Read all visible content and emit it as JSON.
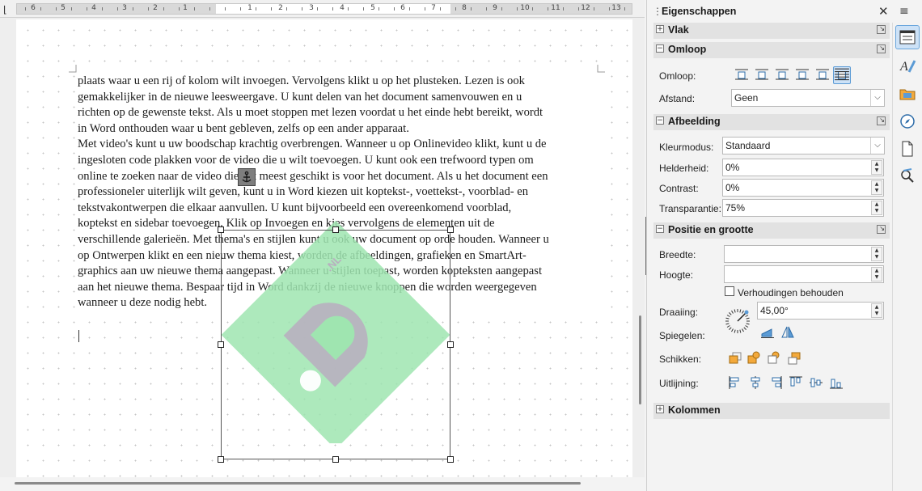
{
  "document": {
    "paragraphs": [
      "plaats waar u een rij of kolom wilt invoegen. Vervolgens klikt u op het plusteken. Lezen is ook",
      "gemakkelijker in de nieuwe leesweergave. U kunt delen van het document samenvouwen en u",
      "richten op de gewenste tekst. Als u moet stoppen met lezen voordat u het einde hebt bereikt, wordt",
      "in Word onthouden waar u bent gebleven, zelfs op een ander apparaat.",
      "Met video's kunt u uw boodschap krachtig overbrengen. Wanneer u op Onlinevideo klikt, kunt u de",
      "ingesloten code plakken voor de video die u wilt toevoegen. U kunt ook een trefwoord typen om",
      "online te zoeken naar de video die het meest geschikt is voor het document. Als u het document een",
      "professioneler uiterlijk wilt geven, kunt u in Word kiezen uit koptekst-, voettekst-, voorblad- en",
      "tekstvakontwerpen die elkaar aanvullen. U kunt bijvoorbeeld een overeenkomend voorblad,",
      "koptekst en sidebar toevoegen. Klik op Invoegen en kies vervolgens de elementen uit de",
      "verschillende galerieën. Met thema's en stijlen kunt u ook uw document op orde houden. Wanneer u",
      "op Ontwerpen klikt en een nieuw thema kiest, worden de afbeeldingen, grafieken en SmartArt-",
      "graphics aan uw nieuwe thema aangepast. Wanneer u stijlen toepast, worden kopteksten aangepast",
      "aan het nieuwe thema. Bespaar tijd in Word dankzij de nieuwe knoppen die worden weergegeven",
      "wanneer u deze nodig hebt."
    ],
    "watermark_text": ".NL",
    "ruler_numbers": [
      "6",
      "5",
      "4",
      "3",
      "2",
      "1",
      "1",
      "2",
      "3",
      "4",
      "5",
      "6",
      "7",
      "8",
      "9",
      "10",
      "11",
      "12",
      "13"
    ]
  },
  "sidebar": {
    "title": "Eigenschappen",
    "close_glyph": "✕",
    "menu_glyph": "≡",
    "sections": {
      "vlak": "Vlak",
      "omloop": "Omloop",
      "afbeelding": "Afbeelding",
      "positie": "Positie en grootte",
      "kolommen": "Kolommen"
    },
    "omloop": {
      "wrap_label": "Omloop:",
      "spacing_label": "Afstand:",
      "spacing_value": "Geen"
    },
    "afbeelding": {
      "color_mode_label": "Kleurmodus:",
      "color_mode_value": "Standaard",
      "brightness_label": "Helderheid:",
      "brightness_value": "0%",
      "contrast_label": "Contrast:",
      "contrast_value": "0%",
      "transparency_label": "Transparantie:",
      "transparency_value": "75%"
    },
    "positie": {
      "width_label": "Breedte:",
      "width_value": "",
      "height_label": "Hoogte:",
      "height_value": "",
      "keep_ratio_label": "Verhoudingen behouden",
      "rotation_label": "Draaiing:",
      "rotation_value": "45,00°",
      "flip_label": "Spiegelen:",
      "arrange_label": "Schikken:",
      "align_label": "Uitlijning:"
    }
  },
  "colors": {
    "watermark_green": "#9fe5b0",
    "watermark_grey": "#b8b0bf",
    "accent": "#5b9bd5",
    "icon_orange": "#f3a93b"
  }
}
